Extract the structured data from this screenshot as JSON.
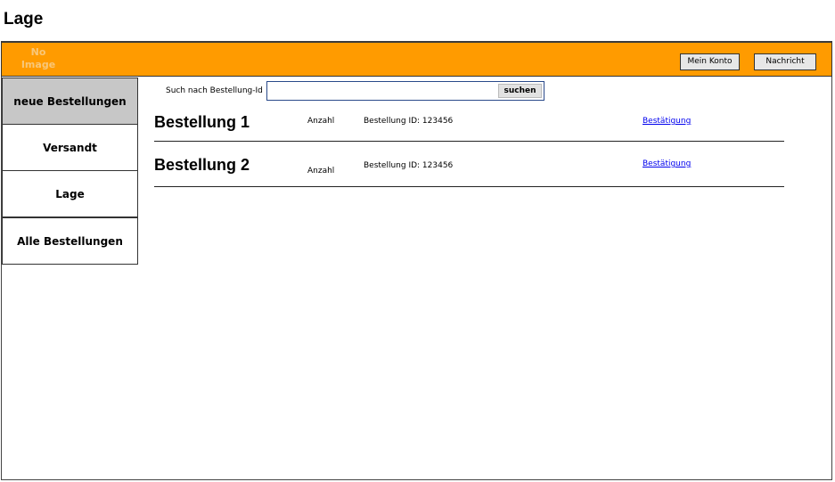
{
  "page": {
    "title": "Lage"
  },
  "header": {
    "logo_placeholder": "No\nImage",
    "account_button": "Mein Konto",
    "message_button": "Nachricht",
    "bar_color": "#ff9b00"
  },
  "sidebar": {
    "items": [
      {
        "label": "neue Bestellungen",
        "active": true
      },
      {
        "label": "Versandt",
        "active": false
      },
      {
        "label": "Lage",
        "active": false
      },
      {
        "label": "Alle Bestellungen",
        "active": false
      }
    ]
  },
  "search": {
    "label": "Such nach Bestellung-Id",
    "value": "",
    "button": "suchen"
  },
  "orders": [
    {
      "title": "Bestellung 1",
      "quantity_label": "Anzahl",
      "id_text": "Bestellung ID: 123456",
      "confirm_link": "Bestätigung"
    },
    {
      "title": "Bestellung 2",
      "quantity_label": "Anzahl",
      "id_text": "Bestellung ID: 123456",
      "confirm_link": "Bestätigung"
    }
  ]
}
